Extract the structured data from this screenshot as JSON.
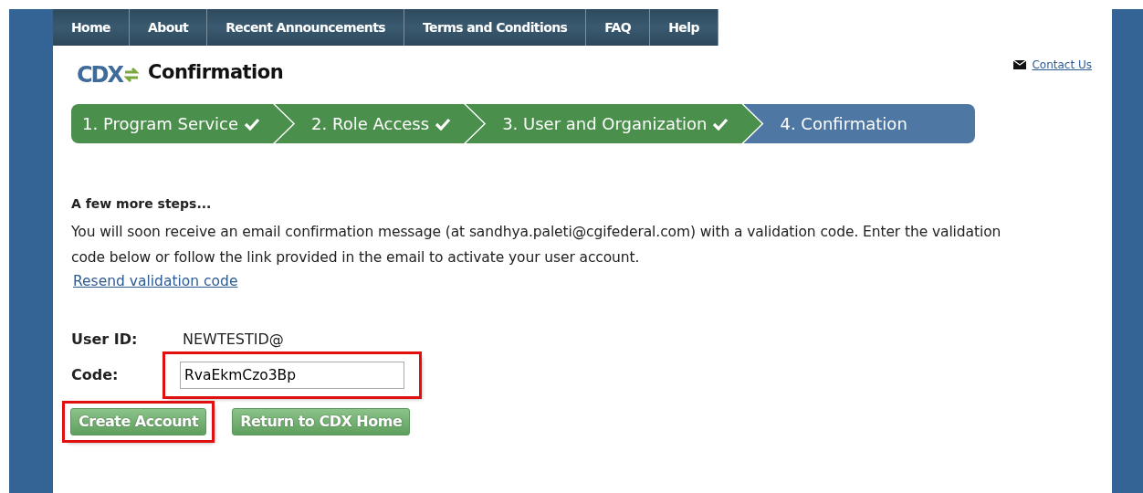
{
  "nav": [
    {
      "label": "Home"
    },
    {
      "label": "About"
    },
    {
      "label": "Recent Announcements"
    },
    {
      "label": "Terms and Conditions"
    },
    {
      "label": "FAQ"
    },
    {
      "label": "Help"
    }
  ],
  "logo": "CDX",
  "page_title": "Confirmation",
  "contact_link": "Contact Us",
  "steps": [
    {
      "label": "1. Program Service",
      "completed": true,
      "selected": false
    },
    {
      "label": "2. Role Access",
      "completed": true,
      "selected": false
    },
    {
      "label": "3. User and Organization",
      "completed": true,
      "selected": false
    },
    {
      "label": "4. Confirmation",
      "completed": false,
      "selected": true
    }
  ],
  "heading": "A few more steps...",
  "message": "You will soon receive an email confirmation message (at sandhya.paleti@cgifederal.com) with a validation code. Enter the validation code below or follow the link provided in the email to activate your user account.",
  "resend_link": "Resend validation code",
  "user_id": {
    "label": "User ID:",
    "value": "NEWTESTID@"
  },
  "code": {
    "label": "Code:",
    "value": "RvaEkmCzo3Bp",
    "highlighted": true
  },
  "buttons": [
    {
      "label": "Create Account",
      "highlighted": true
    },
    {
      "label": "Return to CDX Home",
      "highlighted": false
    }
  ]
}
